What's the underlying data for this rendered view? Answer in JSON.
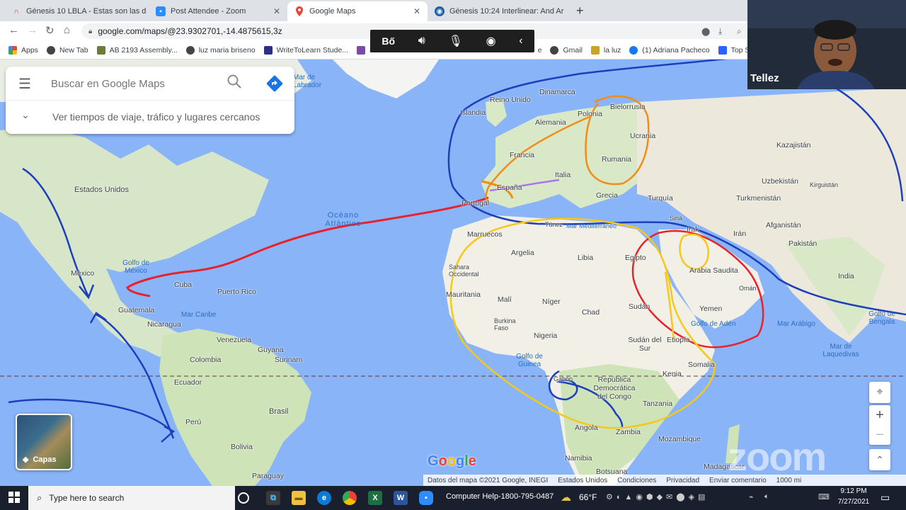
{
  "tabs": [
    {
      "label": "Génesis 10 LBLA - Estas son las d",
      "icon": "bible-icon",
      "close": "✕"
    },
    {
      "label": "Post Attendee - Zoom",
      "icon": "zoom-icon",
      "close": "✕"
    },
    {
      "label": "Google Maps",
      "icon": "maps-pin-icon",
      "close": "✕"
    },
    {
      "label": "Génesis 10:24 Interlinear: And Ar",
      "icon": "biblehub-icon",
      "close": "✕"
    }
  ],
  "new_tab": "+",
  "address": "google.com/maps/@23.9302701,-14.4875615,3z",
  "bookmarks": [
    "Apps",
    "New Tab",
    "AB 2193 Assembly...",
    "luz maria briseno",
    "WriteToLearn Stude...",
    "N",
    "e",
    "Gmail",
    "la luz",
    "(1) Adriana Pacheco",
    "Top St"
  ],
  "search": {
    "placeholder": "Buscar en Google Maps",
    "nearby": "Ver tiempos de viaje, tráfico y lugares cercanos"
  },
  "zoom_participant": "Tellez",
  "labels": {
    "countries": [
      "Estados Unidos",
      "México",
      "Cuba",
      "Puerto Rico",
      "Guatemala",
      "Nicaragua",
      "Venezuela",
      "Guyana",
      "Surinam",
      "Colombia",
      "Ecuador",
      "Perú",
      "Brasil",
      "Bolivia",
      "Paraguay",
      "Islandia",
      "Reino Unido",
      "Dinamarca",
      "Polonia",
      "Bielorrusia",
      "Alemania",
      "Ucrania",
      "Francia",
      "Rumania",
      "Italia",
      "España",
      "Portugal",
      "Grecia",
      "Turquía",
      "Kazajistán",
      "Uzbekistán",
      "Kirguistán",
      "Turkmenistán",
      "Siria",
      "Irak",
      "Irán",
      "Afganistán",
      "Pakistán",
      "India",
      "Túnez",
      "Marruecos",
      "Argelia",
      "Libia",
      "Egipto",
      "Arabia Saudita",
      "Omán",
      "Yemen",
      "Sahara Occidental",
      "Mauritania",
      "Malí",
      "Níger",
      "Chad",
      "Sudán",
      "Burkina Faso",
      "Nigeria",
      "Sudán del Sur",
      "Etiopía",
      "Somalia",
      "Kenia",
      "Gabón",
      "República Democrática del Congo",
      "Tanzania",
      "Angola",
      "Zambia",
      "Mozambique",
      "Namibia",
      "Botsuana",
      "Madagascar"
    ],
    "seas": [
      "Mar de Labrador",
      "Océano Atlántico",
      "Golfo de México",
      "Mar Caribe",
      "Mar Mediterráneo",
      "Golfo de Adén",
      "Mar Arábigo",
      "Golfo de Bengala",
      "Golfo de Guinea",
      "Mar de Laquedivas"
    ]
  },
  "layers_button": "Capas",
  "google_logo": "Google",
  "attribution": [
    "Datos del mapa ©2021 Google, INEGI",
    "Estados Unidos",
    "Condiciones",
    "Privacidad",
    "Enviar comentario",
    "1000 mi"
  ],
  "zoom_watermark": "zoom",
  "taskbar": {
    "search_placeholder": "Type here to search",
    "zoom_help": "Computer Help-1800-795-0487",
    "temperature": "66°F",
    "time": "9:12 PM",
    "date": "7/27/2021"
  },
  "colors": {
    "red": "#e8212b",
    "blue": "#1d3fbd",
    "orange": "#f08c1a",
    "yellow": "#f5c918",
    "purple": "#a774f0",
    "sea": "#8ab4f8",
    "land": "#f1efe6",
    "green": "#cfe3b8"
  }
}
